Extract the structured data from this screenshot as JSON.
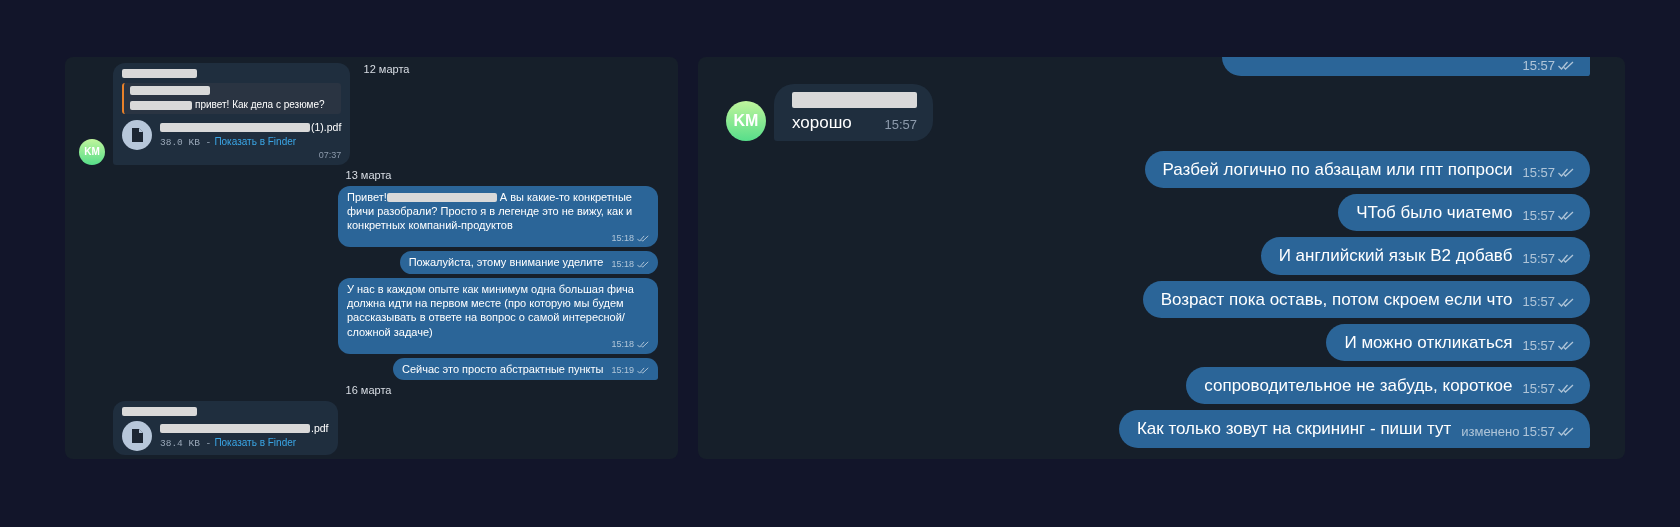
{
  "panels": [
    {
      "items": [
        {
          "kind": "date",
          "text": "12 марта"
        },
        {
          "kind": "incoming",
          "avatar": "KM",
          "sender_redacted": true,
          "tail": true,
          "reply": {
            "name_redacted": true,
            "parts": [
              {
                "kind": "redacted"
              },
              {
                "kind": "text",
                "text": "привет! Как дела с резюме?"
              }
            ]
          },
          "file": {
            "name": [
              {
                "kind": "redacted"
              },
              {
                "kind": "text",
                "text": "(1).pdf"
              }
            ],
            "size": "38.0 KB -",
            "link": "Показать в Finder"
          },
          "time": "07:37"
        },
        {
          "kind": "date",
          "text": "13 марта"
        },
        {
          "kind": "outgoing",
          "tail": false,
          "parts": [
            {
              "kind": "text",
              "text": "Привет!"
            },
            {
              "kind": "redacted"
            },
            {
              "kind": "text",
              "text": " А вы какие-то конкретные фичи разобрали? Просто я в легенде это не вижу, как и конкретных компаний-продуктов"
            }
          ],
          "time": "15:18",
          "read": true
        },
        {
          "kind": "outgoing",
          "tail": false,
          "parts": [
            {
              "kind": "text",
              "text": "Пожалуйста, этому внимание уделите"
            }
          ],
          "time": "15:18",
          "read": true
        },
        {
          "kind": "outgoing",
          "tail": false,
          "parts": [
            {
              "kind": "text",
              "text": "У нас в каждом опыте как минимум одна большая фича должна идти на первом месте (про которую мы будем рассказывать в ответе на вопрос о самой интересной/сложной задаче)"
            }
          ],
          "time": "15:18",
          "read": true
        },
        {
          "kind": "outgoing",
          "tail": true,
          "parts": [
            {
              "kind": "text",
              "text": "Сейчас это просто абстрактные пункты"
            }
          ],
          "time": "15:19",
          "read": true
        },
        {
          "kind": "date",
          "text": "16 марта"
        },
        {
          "kind": "incoming",
          "sender_redacted": true,
          "tail": false,
          "file": {
            "name": [
              {
                "kind": "redacted"
              },
              {
                "kind": "text",
                "text": ".pdf"
              }
            ],
            "size": "38.4 KB -",
            "link": "Показать в Finder"
          }
        }
      ]
    },
    {
      "items": [
        {
          "kind": "outgoing",
          "tail": true,
          "time": "15:57",
          "read": true
        },
        {
          "kind": "incoming",
          "avatar": "KM",
          "sender_redacted": true,
          "tail": true,
          "parts": [
            {
              "kind": "text",
              "text": "хорошо"
            }
          ],
          "time": "15:57"
        },
        {
          "kind": "outgoing",
          "tail": false,
          "parts": [
            {
              "kind": "text",
              "text": "Разбей логично по абзацам или гпт попроси"
            }
          ],
          "time": "15:57",
          "read": true
        },
        {
          "kind": "outgoing",
          "tail": false,
          "parts": [
            {
              "kind": "text",
              "text": "ЧТоб было чиатемо"
            }
          ],
          "time": "15:57",
          "read": true
        },
        {
          "kind": "outgoing",
          "tail": false,
          "parts": [
            {
              "kind": "text",
              "text": "И английский язык B2 добавб"
            }
          ],
          "time": "15:57",
          "read": true
        },
        {
          "kind": "outgoing",
          "tail": false,
          "parts": [
            {
              "kind": "text",
              "text": "Возраст пока оставь, потом скроем если что"
            }
          ],
          "time": "15:57",
          "read": true
        },
        {
          "kind": "outgoing",
          "tail": false,
          "parts": [
            {
              "kind": "text",
              "text": "И можно откликаться"
            }
          ],
          "time": "15:57",
          "read": true
        },
        {
          "kind": "outgoing",
          "tail": false,
          "parts": [
            {
              "kind": "text",
              "text": "сопроводительное не забудь, короткое"
            }
          ],
          "time": "15:57",
          "read": true
        },
        {
          "kind": "outgoing",
          "tail": true,
          "parts": [
            {
              "kind": "text",
              "text": "Как только зовут на скрининг - пиши тут"
            }
          ],
          "edited": "изменено",
          "time": "15:57",
          "read": true
        }
      ]
    }
  ]
}
